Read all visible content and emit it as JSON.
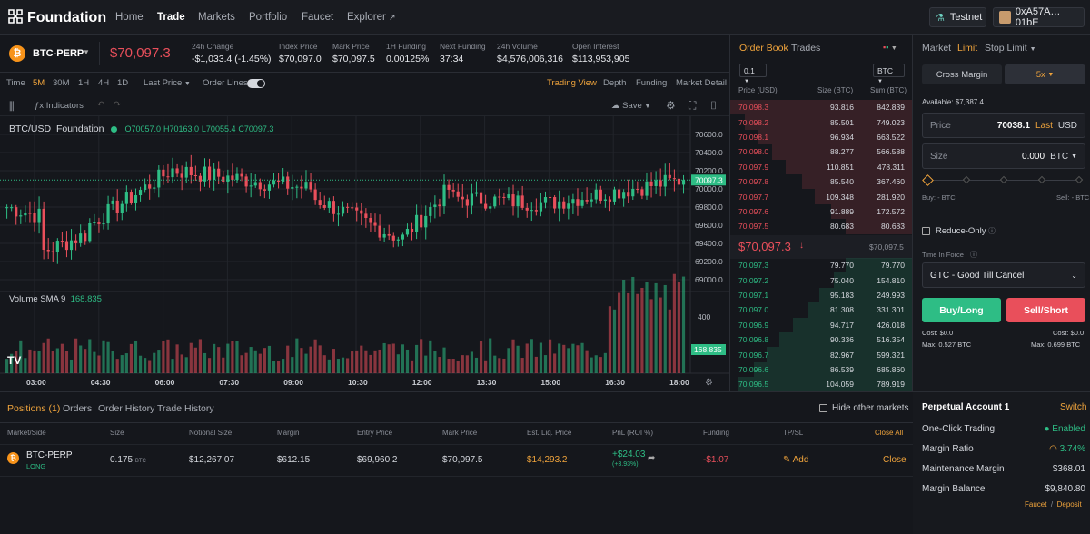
{
  "nav": {
    "brand": "Foundation",
    "links": [
      "Home",
      "Trade",
      "Markets",
      "Portfolio",
      "Faucet",
      "Explorer"
    ],
    "network": "Testnet",
    "wallet": "0xA57A…01bE"
  },
  "ticker": {
    "symbol": "BTC-PERP",
    "price": "$70,097.3",
    "stats": [
      {
        "label": "24h Change",
        "value": "-$1,033.4 (-1.45%)",
        "color": "red"
      },
      {
        "label": "Index Price",
        "value": "$70,097.0",
        "color": ""
      },
      {
        "label": "Mark Price",
        "value": "$70,097.5",
        "color": ""
      },
      {
        "label": "1H Funding",
        "value": "0.00125%",
        "color": "green"
      },
      {
        "label": "Next Funding",
        "value": "37:34",
        "color": ""
      },
      {
        "label": "24h Volume",
        "value": "$4,576,006,316",
        "color": ""
      },
      {
        "label": "Open Interest",
        "value": "$113,953,905",
        "color": ""
      }
    ]
  },
  "toolbar": {
    "time_label": "Time",
    "intervals": [
      "5M",
      "30M",
      "1H",
      "4H",
      "1D"
    ],
    "active_interval": "5M",
    "price_type": "Last Price",
    "order_lines": "Order Lines",
    "views": [
      "Trading View",
      "Depth",
      "Funding",
      "Market Detail"
    ],
    "indicators": "Indicators",
    "save": "Save"
  },
  "chart": {
    "pair": "BTC/USD",
    "source": "Foundation",
    "ohlc": {
      "o": "O70057.0",
      "h": "H70163.0",
      "l": "L70055.4",
      "c": "C70097.3"
    },
    "price_ticks": [
      "70600.0",
      "70400.0",
      "70200.0",
      "70000.0",
      "69800.0",
      "69600.0",
      "69400.0",
      "69200.0",
      "69000.0"
    ],
    "current_price": "70097.3",
    "volume_label": "Volume SMA 9",
    "volume_value": "168.835",
    "volume_tick": "400",
    "volume_tick2": "200",
    "time_ticks": [
      "03:00",
      "04:30",
      "06:00",
      "07:30",
      "09:00",
      "10:30",
      "12:00",
      "13:30",
      "15:00",
      "16:30",
      "18:00"
    ]
  },
  "orderbook": {
    "tabs": [
      "Order Book",
      "Trades"
    ],
    "size_step": "0.1",
    "unit": "BTC",
    "headers": [
      "Price (USD)",
      "Size (BTC)",
      "Sum (BTC)"
    ],
    "asks": [
      [
        "70,098.3",
        "93.816",
        "842.839"
      ],
      [
        "70,098.2",
        "85.501",
        "749.023"
      ],
      [
        "70,098.1",
        "96.934",
        "663.522"
      ],
      [
        "70,098.0",
        "88.277",
        "566.588"
      ],
      [
        "70,097.9",
        "110.851",
        "478.311"
      ],
      [
        "70,097.8",
        "85.540",
        "367.460"
      ],
      [
        "70,097.7",
        "109.348",
        "281.920"
      ],
      [
        "70,097.6",
        "91.889",
        "172.572"
      ],
      [
        "70,097.5",
        "80.683",
        "80.683"
      ]
    ],
    "mid": "$70,097.3",
    "mid_right": "$70,097.5",
    "bids": [
      [
        "70,097.3",
        "79.770",
        "79.770"
      ],
      [
        "70,097.2",
        "75.040",
        "154.810"
      ],
      [
        "70,097.1",
        "95.183",
        "249.993"
      ],
      [
        "70,097.0",
        "81.308",
        "331.301"
      ],
      [
        "70,096.9",
        "94.717",
        "426.018"
      ],
      [
        "70,096.8",
        "90.336",
        "516.354"
      ],
      [
        "70,096.7",
        "82.967",
        "599.321"
      ],
      [
        "70,096.6",
        "86.539",
        "685.860"
      ],
      [
        "70,096.5",
        "104.059",
        "789.919"
      ]
    ]
  },
  "order": {
    "tabs": [
      "Market",
      "Limit",
      "Stop Limit"
    ],
    "margin_mode": "Cross Margin",
    "leverage": "5x",
    "available": "Available: $7,387.4",
    "price_label": "Price",
    "price_value": "70038.1",
    "price_last": "Last",
    "price_unit": "USD",
    "size_label": "Size",
    "size_value": "0.000",
    "size_unit": "BTC",
    "buy_hint": "Buy: - BTC",
    "sell_hint": "Sell: - BTC",
    "reduce_only": "Reduce-Only",
    "tif_label": "Time In Force",
    "tif_value": "GTC - Good Till Cancel",
    "buy": "Buy/Long",
    "sell": "Sell/Short",
    "cost_buy": "Cost: $0.0",
    "cost_sell": "Cost: $0.0",
    "max_buy": "Max: 0.527 BTC",
    "max_sell": "Max: 0.699 BTC"
  },
  "account": {
    "title": "Perpetual Account 1",
    "switch": "Switch",
    "rows": [
      [
        "One-Click Trading",
        "Enabled"
      ],
      [
        "Margin Ratio",
        "3.74%"
      ],
      [
        "Maintenance Margin",
        "$368.01"
      ],
      [
        "Margin Balance",
        "$9,840.80"
      ]
    ],
    "faucet": "Faucet",
    "deposit": "Deposit",
    "sep": "/"
  },
  "positions": {
    "tabs": [
      "Positions (1)",
      "Orders",
      "Order History",
      "Trade History"
    ],
    "hide_label": "Hide other markets",
    "headers": [
      "Market/Side",
      "Size",
      "Notional Size",
      "Margin",
      "Entry Price",
      "Mark Price",
      "Est. Liq. Price",
      "PnL (ROI %)",
      "Funding",
      "TP/SL"
    ],
    "close_all": "Close All",
    "row": {
      "market": "BTC-PERP",
      "side": "LONG",
      "size": "0.175",
      "size_unit": "BTC",
      "notional": "$12,267.07",
      "margin": "$612.15",
      "entry": "$69,960.2",
      "mark": "$70,097.5",
      "liq": "$14,293.2",
      "pnl": "+$24.03",
      "roi": "(+3.93%)",
      "funding": "-$1.07",
      "tpsl": "Add",
      "close": "Close"
    }
  },
  "colors": {
    "green": "#2ebd85",
    "red": "#e94f5b",
    "accent": "#f0a43c"
  }
}
